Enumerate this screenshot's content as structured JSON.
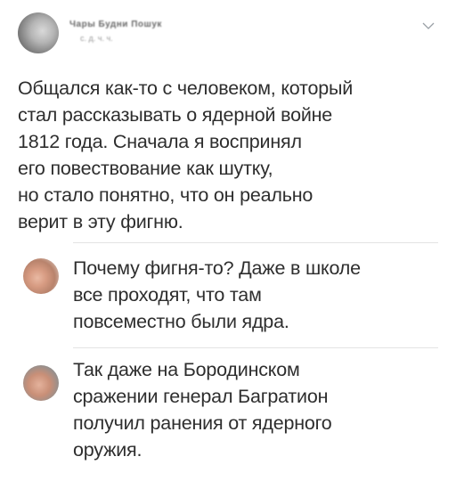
{
  "post": {
    "author_name": "Чары Будни Пошук",
    "author_handle": "с. д. ч. ч.",
    "text": "Общался как-то с человеком, который\nстал рассказывать о ядерной войне\n1812 года. Сначала я воспринял\nего повествование как шутку,\nно стало понятно, что он реально\nверит в эту фигню."
  },
  "comments": [
    {
      "text": "Почему фигня-то? Даже в школе\nвсе проходят, что там\nповсеместно были ядра."
    },
    {
      "text": "Так даже на Бородинском\nсражении генерал Багратион\nполучил ранения от ядерного\nоружия."
    }
  ],
  "icons": {
    "menu": "chevron-down-icon"
  },
  "colors": {
    "text": "#2e2e2e",
    "divider": "#e3e3e3",
    "chevron": "#9aa0a6"
  }
}
